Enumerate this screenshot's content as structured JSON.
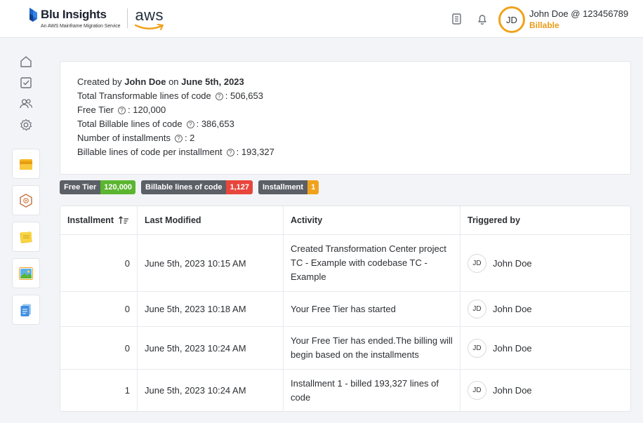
{
  "header": {
    "brand_name": "Blu Insights",
    "brand_sub": "An AWS Mainframe Migration Service",
    "aws_text": "aws",
    "user_initials": "JD",
    "user_name": "John Doe @ 123456789",
    "user_plan": "Billable"
  },
  "sidebar": {
    "icons": [
      "home-icon",
      "tasks-icon",
      "users-icon",
      "settings-icon"
    ],
    "tiles": [
      "folder-icon",
      "package-icon",
      "sticky-note-icon",
      "image-icon",
      "documents-icon"
    ]
  },
  "info": {
    "created_prefix": "Created by",
    "created_by": "John Doe",
    "created_on_word": "on",
    "created_date": "June 5th, 2023",
    "lines": [
      {
        "label": "Total Transformable lines of code",
        "value": ": 506,653"
      },
      {
        "label": "Free Tier",
        "value": ": 120,000"
      },
      {
        "label": "Total Billable lines of code",
        "value": ": 386,653"
      },
      {
        "label": "Number of installments",
        "value": ": 2"
      },
      {
        "label": "Billable lines of code per installment",
        "value": ": 193,327"
      }
    ],
    "help_glyph": "?"
  },
  "badges": [
    {
      "label": "Free Tier",
      "value": "120,000",
      "color": "#5cb531"
    },
    {
      "label": "Billable lines of code",
      "value": "1,127",
      "color": "#e8453c"
    },
    {
      "label": "Installment",
      "value": "1",
      "color": "#f0a21b"
    }
  ],
  "table": {
    "headers": {
      "installment": "Installment",
      "last_modified": "Last Modified",
      "activity": "Activity",
      "triggered_by": "Triggered by"
    },
    "rows": [
      {
        "installment": "0",
        "modified": "June 5th, 2023 10:15 AM",
        "activity": "Created Transformation Center project TC - Example with codebase TC - Example",
        "initials": "JD",
        "user": "John Doe"
      },
      {
        "installment": "0",
        "modified": "June 5th, 2023 10:18 AM",
        "activity": "Your Free Tier has started",
        "initials": "JD",
        "user": "John Doe"
      },
      {
        "installment": "0",
        "modified": "June 5th, 2023 10:24 AM",
        "activity": "Your Free Tier has ended.The billing will begin based on the installments",
        "initials": "JD",
        "user": "John Doe"
      },
      {
        "installment": "1",
        "modified": "June 5th, 2023 10:24 AM",
        "activity": "Installment 1 - billed 193,327 lines of code",
        "initials": "JD",
        "user": "John Doe"
      }
    ]
  },
  "colors": {
    "accent": "#f0a21b",
    "brand_blue": "#1f6fd1"
  }
}
